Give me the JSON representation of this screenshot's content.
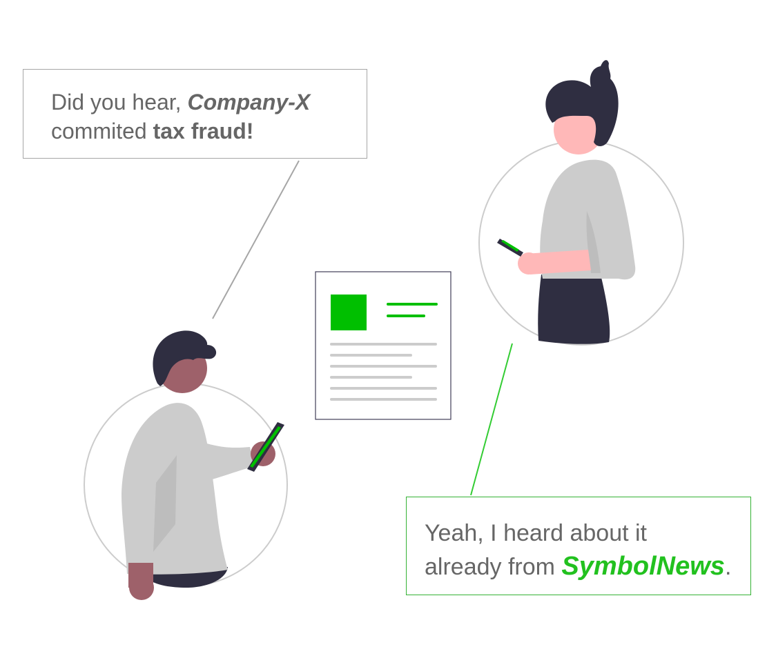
{
  "colors": {
    "accent_green": "#00bf00",
    "line_green": "#33cc33",
    "dark_hair": "#2f2e41",
    "shirt_gray": "#cccccc",
    "skin_dark": "#9e616a",
    "skin_light": "#ffb8b8",
    "border_gray": "#a6a6a6",
    "text_gray": "#666666"
  },
  "icons": {
    "person_left": "man-holding-phone-icon",
    "person_right": "woman-holding-phone-icon",
    "article": "news-article-icon"
  },
  "bubble_left": {
    "part1": "Did you hear, ",
    "company": "Company-X",
    "part2": "commited ",
    "emphasis": "tax fraud!"
  },
  "bubble_right": {
    "part1": "Yeah, I heard about it",
    "part2": "already from ",
    "brand": "SymbolNews",
    "part3": "."
  }
}
